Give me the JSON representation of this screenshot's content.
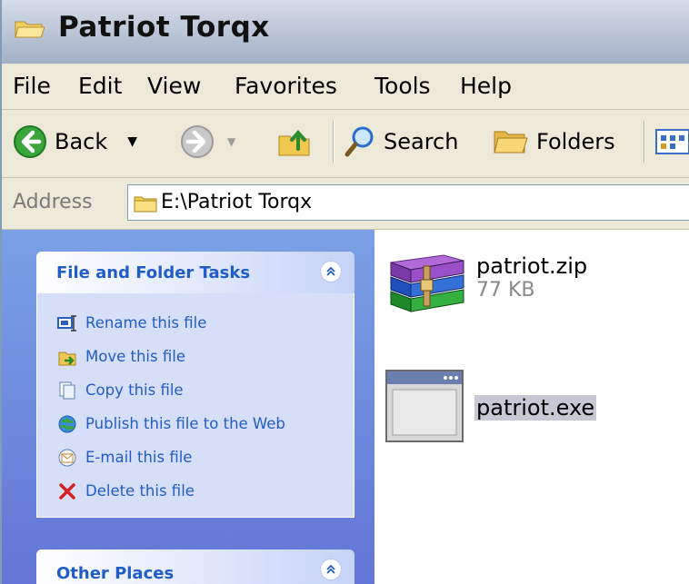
{
  "window": {
    "title": "Patriot Torqx"
  },
  "menu": [
    "File",
    "Edit",
    "View",
    "Favorites",
    "Tools",
    "Help"
  ],
  "toolbar": {
    "back": "Back",
    "search": "Search",
    "folders": "Folders"
  },
  "address": {
    "label": "Address",
    "path": "E:\\Patriot Torqx"
  },
  "sidebar": {
    "file_tasks": {
      "title": "File and Folder Tasks",
      "items": [
        {
          "label": "Rename this file",
          "icon": "rename-icon"
        },
        {
          "label": "Move this file",
          "icon": "move-icon"
        },
        {
          "label": "Copy this file",
          "icon": "copy-icon"
        },
        {
          "label": "Publish this file to the Web",
          "icon": "globe-icon"
        },
        {
          "label": "E-mail this file",
          "icon": "email-icon"
        },
        {
          "label": "Delete this file",
          "icon": "delete-icon"
        }
      ]
    },
    "other_places": {
      "title": "Other Places"
    }
  },
  "files": [
    {
      "name": "patriot.zip",
      "size": "77 KB",
      "icon": "winrar-archive-icon"
    },
    {
      "name": "patriot.exe",
      "size": "",
      "icon": "application-exe-icon",
      "selected": true
    }
  ],
  "colors": {
    "link": "#215dc6",
    "sidebar_top": "#7aa1e6",
    "sidebar_bottom": "#6375d6"
  }
}
